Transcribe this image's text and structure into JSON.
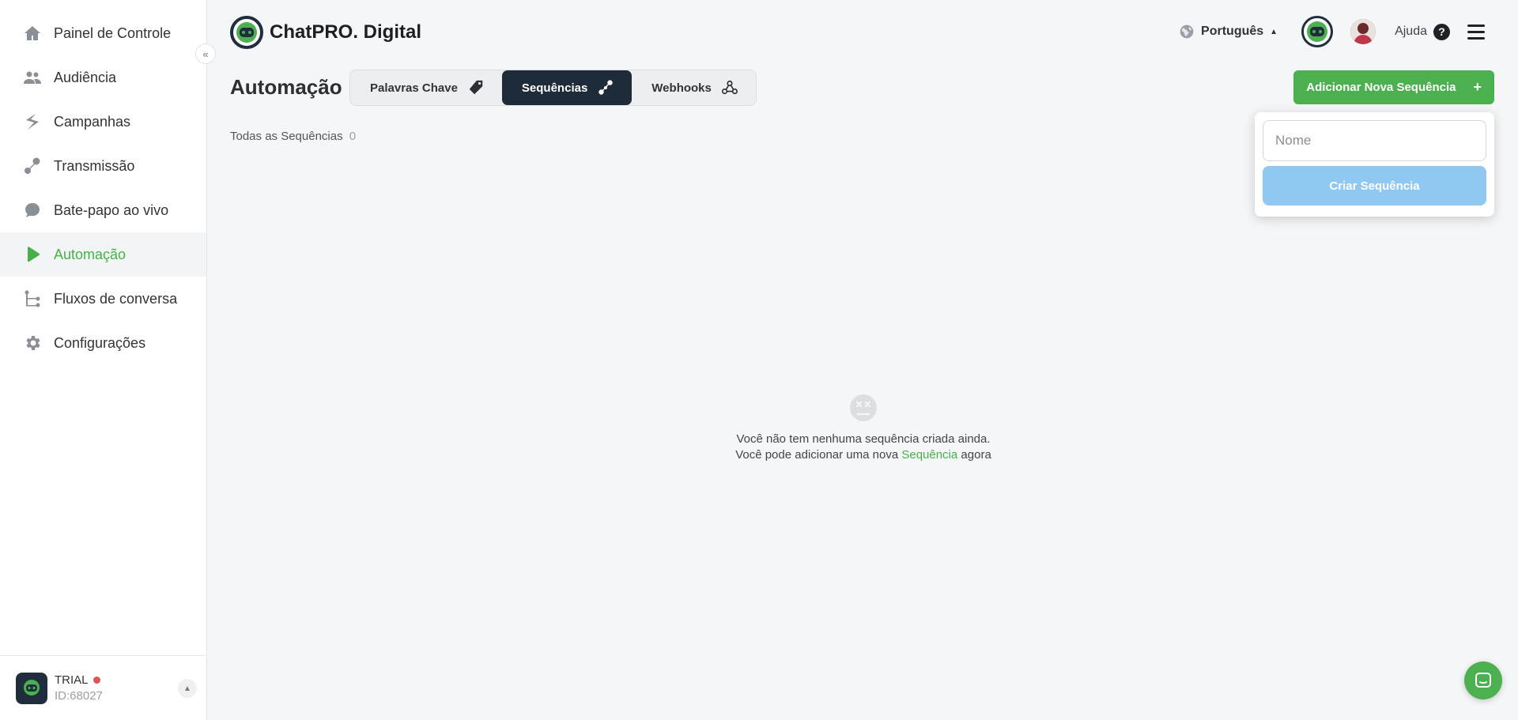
{
  "app": {
    "brand_name": "ChatPRO. Digital"
  },
  "sidebar": {
    "items": [
      {
        "label": "Painel de Controle",
        "icon": "home-icon",
        "active": false
      },
      {
        "label": "Audiência",
        "icon": "people-icon",
        "active": false
      },
      {
        "label": "Campanhas",
        "icon": "campaign-icon",
        "active": false
      },
      {
        "label": "Transmissão",
        "icon": "broadcast-icon",
        "active": false
      },
      {
        "label": "Bate-papo ao vivo",
        "icon": "chat-bubble-icon",
        "active": false
      },
      {
        "label": "Automação",
        "icon": "play-icon",
        "active": true
      },
      {
        "label": "Fluxos de conversa",
        "icon": "flow-icon",
        "active": false
      },
      {
        "label": "Configurações",
        "icon": "gear-icon",
        "active": false
      }
    ],
    "collapse_icon": "chevrons-left-icon",
    "account": {
      "plan": "TRIAL",
      "id": "ID:68027",
      "status_color": "#e05454"
    }
  },
  "header": {
    "language": "Português",
    "help_label": "Ajuda"
  },
  "main": {
    "title": "Automação",
    "tabs": [
      {
        "label": "Palavras Chave",
        "icon": "tag-icon",
        "active": false
      },
      {
        "label": "Sequências",
        "icon": "sequence-icon",
        "active": true
      },
      {
        "label": "Webhooks",
        "icon": "webhook-icon",
        "active": false
      }
    ],
    "add_button_label": "Adicionar Nova Sequência",
    "filter_label": "Todas as Sequências",
    "filter_count": "0",
    "empty_state": {
      "line1": "Você não tem nenhuma sequência criada ainda.",
      "line2_prefix": "Você pode adicionar uma nova",
      "line2_link": "Sequência",
      "line2_suffix": "agora"
    }
  },
  "popover": {
    "name_placeholder": "Nome",
    "name_value": "",
    "create_button_label": "Criar Sequência"
  },
  "colors": {
    "accent": "#4caf50",
    "active_nav": "#47b04b",
    "dark": "#1e2b38",
    "disabled_button": "#90c8f1"
  }
}
